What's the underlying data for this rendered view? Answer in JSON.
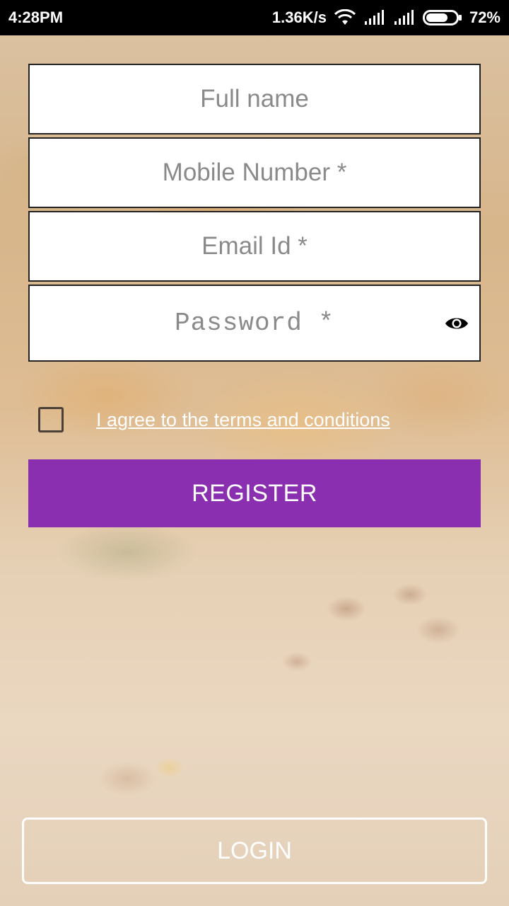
{
  "status_bar": {
    "time": "4:28PM",
    "network_speed": "1.36K/s",
    "battery_percent": "72%",
    "battery_level": 0.72,
    "icons": [
      "wifi-icon",
      "signal-icon",
      "signal-icon",
      "battery-icon"
    ]
  },
  "form": {
    "full_name": {
      "placeholder": "Full name",
      "value": ""
    },
    "mobile": {
      "placeholder": "Mobile Number *",
      "value": ""
    },
    "email": {
      "placeholder": "Email Id *",
      "value": ""
    },
    "password": {
      "placeholder": "Password *",
      "value": "",
      "toggle_icon": "eye-icon"
    },
    "terms": {
      "label": "I agree to the terms and conditions",
      "checked": false
    }
  },
  "buttons": {
    "register": "REGISTER",
    "login": "LOGIN"
  },
  "colors": {
    "accent": "#8a2fb0",
    "status_bar": "#000000"
  }
}
